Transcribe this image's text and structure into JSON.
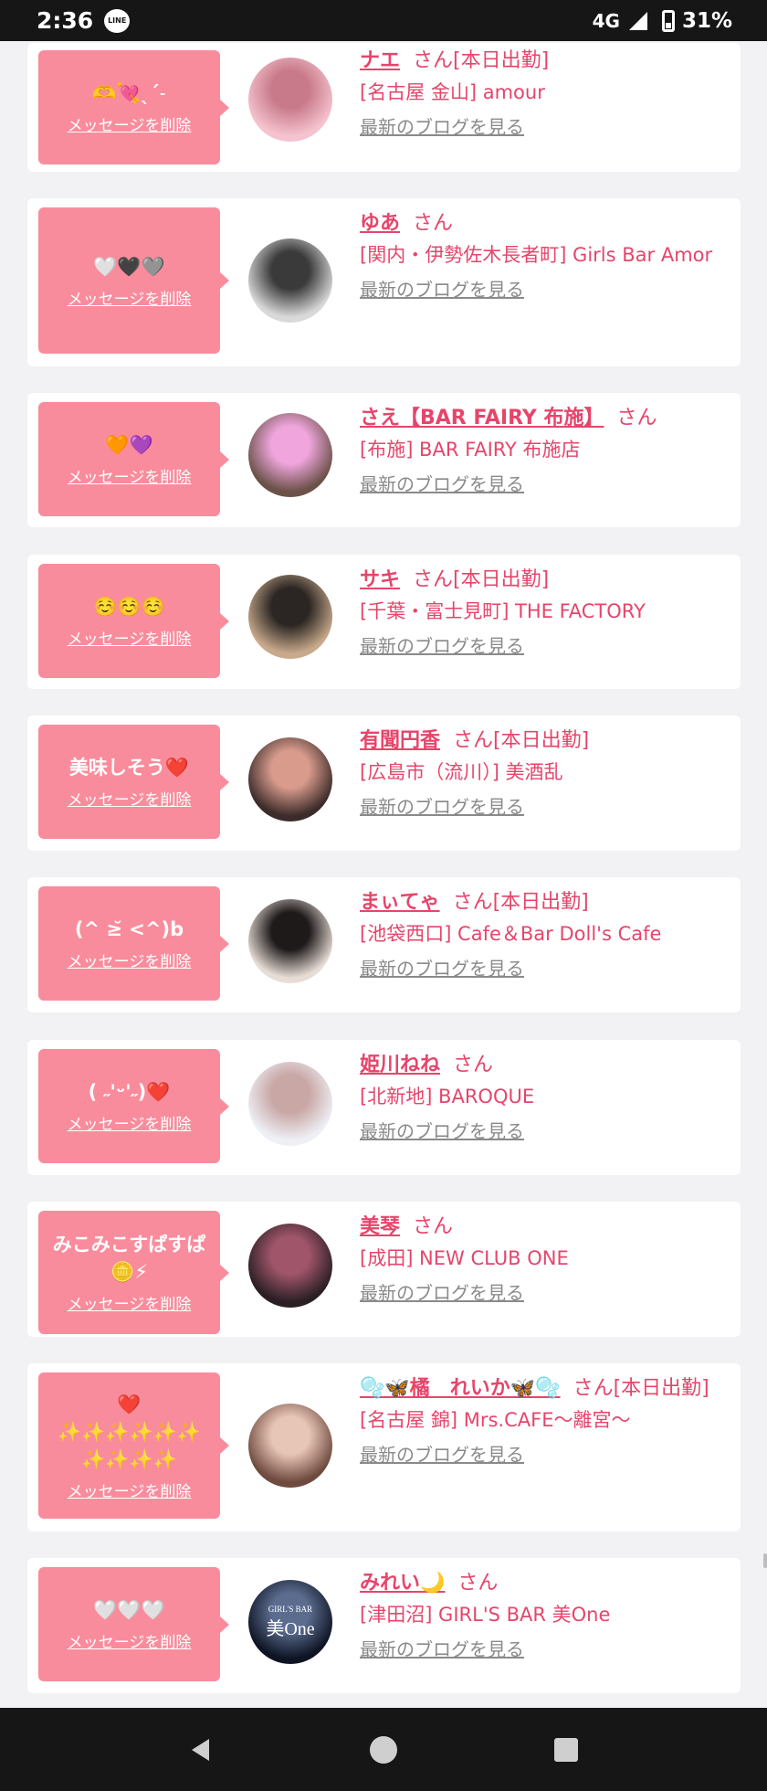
{
  "status": {
    "time": "2:36",
    "line_app": "LINE",
    "network": "4G",
    "battery_pct": "31%",
    "battery_level": 0.31
  },
  "entries": [
    {
      "message": "🫶💘ˎˊ˗",
      "delete_label": "メッセージを削除",
      "name": "ナエ",
      "suffix": "さん[本日出勤]",
      "shop": "[名古屋 金山] amour",
      "blog_label": "最新のブログを見る",
      "avatar_colors": [
        "#f5c3cf",
        "#c97a8a"
      ]
    },
    {
      "message": "🤍🖤🩶",
      "delete_label": "メッセージを削除",
      "name": "ゆあ",
      "suffix": "さん",
      "shop": "[関内・伊勢佐木長者町] Girls Bar Amor",
      "blog_label": "最新のブログを見る",
      "avatar_colors": [
        "#d9d9d9",
        "#3a3a3a"
      ]
    },
    {
      "message": "🧡💜",
      "delete_label": "メッセージを削除",
      "name": "さえ【BAR FAIRY 布施】",
      "suffix": "さん",
      "shop": "[布施] BAR FAIRY 布施店",
      "blog_label": "最新のブログを見る",
      "avatar_colors": [
        "#6b5148",
        "#f0a6dd"
      ]
    },
    {
      "message": "☺️☺️☺️",
      "delete_label": "メッセージを削除",
      "name": "サキ",
      "suffix": "さん[本日出勤]",
      "shop": "[千葉・富士見町] THE FACTORY",
      "blog_label": "最新のブログを見る",
      "avatar_colors": [
        "#c8a98b",
        "#2b2623"
      ]
    },
    {
      "message": "美味しそう❤️",
      "delete_label": "メッセージを削除",
      "name": "有聞円香",
      "suffix": "さん[本日出勤]",
      "shop": "[広島市（流川）] 美酒乱",
      "blog_label": "最新のブログを見る",
      "avatar_colors": [
        "#3b2b2a",
        "#d89b8c"
      ]
    },
    {
      "message": "(^ ≥̆ <^)b",
      "delete_label": "メッセージを削除",
      "name": "まぃてゃ",
      "suffix": "さん[本日出勤]",
      "shop": "[池袋西口] Cafe＆Bar Doll's Cafe",
      "blog_label": "最新のブログを見る",
      "avatar_colors": [
        "#e8ddd6",
        "#1e1a1a"
      ]
    },
    {
      "message": "( ˶'ᵕ'˶)❤️",
      "delete_label": "メッセージを削除",
      "name": "姫川ねね",
      "suffix": "さん",
      "shop": "[北新地] BAROQUE",
      "blog_label": "最新のブログを見る",
      "avatar_colors": [
        "#eef0f6",
        "#c9a7a5"
      ]
    },
    {
      "message": "みこみこすぱすぱ🪙⚡",
      "delete_label": "メッセージを削除",
      "name": "美琴",
      "suffix": "さん",
      "shop": "[成田] NEW CLUB ONE",
      "blog_label": "最新のブログを見る",
      "avatar_colors": [
        "#2a1f24",
        "#a0556a"
      ]
    },
    {
      "message": "❤️ ✨✨✨✨✨✨ ✨✨✨✨",
      "delete_label": "メッセージを削除",
      "name": "🫧🦋橘　れいか🦋🫧",
      "suffix": "さん[本日出勤]",
      "shop": "[名古屋 錦] Mrs.CAFE〜離宮〜",
      "blog_label": "最新のブログを見る",
      "avatar_colors": [
        "#6e4a3f",
        "#e8c6b7"
      ]
    },
    {
      "message": "🤍🤍🤍",
      "delete_label": "メッセージを削除",
      "name": "みれい🌙",
      "suffix": "さん",
      "shop": "[津田沼] GIRL'S BAR 美One",
      "blog_label": "最新のブログを見る",
      "avatar_colors": [
        "#0e1423",
        "#5b6c8f"
      ],
      "avatar_text": "美One",
      "avatar_caption": "GIRL'S BAR"
    }
  ]
}
